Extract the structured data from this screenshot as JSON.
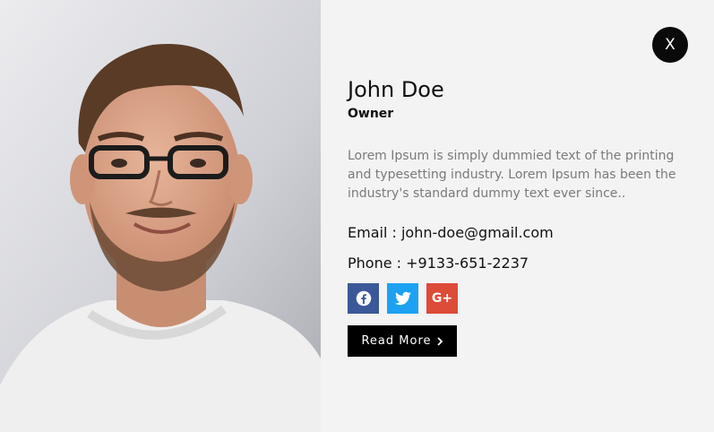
{
  "profile": {
    "name": "John Doe",
    "role": "Owner",
    "bio": "Lorem Ipsum is simply dummied text of the printing and typesetting industry. Lorem Ipsum has been the industry's standard dummy text ever since..",
    "email_text": "Email : john-doe@gmail.com",
    "phone_text": "Phone : +9133-651-2237"
  },
  "close": {
    "label": "X"
  },
  "social": {
    "facebook_icon": "facebook-icon",
    "twitter_icon": "twitter-icon",
    "googleplus_label": "G+"
  },
  "read_more": {
    "label": "Read More",
    "icon": "chevron-right-icon"
  },
  "colors": {
    "facebook": "#3b5998",
    "twitter": "#1da1f2",
    "googleplus": "#dd4b39",
    "panel_bg": "#f3f3f3",
    "button_bg": "#000000"
  }
}
